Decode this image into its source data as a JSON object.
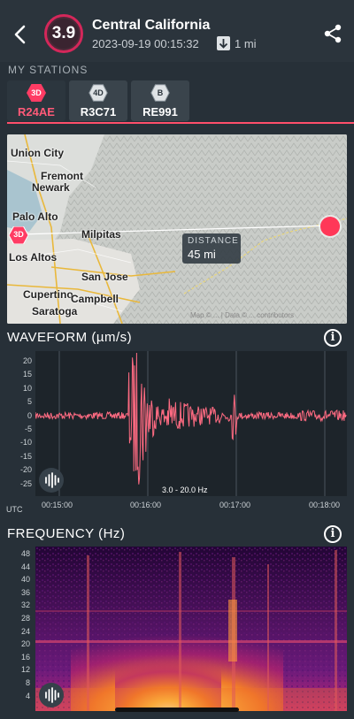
{
  "header": {
    "magnitude": "3.9",
    "title": "Central California",
    "datetime": "2023-09-19 00:15:32",
    "depth": "1 mi"
  },
  "stations": {
    "label": "MY STATIONS",
    "items": [
      {
        "type": "3D",
        "code": "R24AE",
        "selected": true
      },
      {
        "type": "4D",
        "code": "R3C71",
        "selected": false
      },
      {
        "type": "B",
        "code": "RE991",
        "selected": false
      }
    ]
  },
  "map": {
    "places": [
      "Union City",
      "Fremont",
      "Newark",
      "Palo Alto",
      "Milpitas",
      "Los Altos",
      "San Jose",
      "Cupertino",
      "Campbell",
      "Saratoga"
    ],
    "distance_label": "DISTANCE",
    "distance_value": "45 mi",
    "station_marker": "3D",
    "attribution": "Map © ... | Data © ... contributors"
  },
  "waveform": {
    "title": "WAVEFORM (µm/s)",
    "y_ticks": [
      "20",
      "15",
      "10",
      "5",
      "0",
      "-5",
      "-10",
      "-15",
      "-20",
      "-25"
    ],
    "x_axis_unit": "UTC",
    "x_ticks": [
      "00:15:00",
      "00:16:00",
      "00:17:00",
      "00:18:00"
    ],
    "filter": "3.0 - 20.0 Hz"
  },
  "frequency": {
    "title": "FREQUENCY (Hz)",
    "y_ticks": [
      "48",
      "44",
      "40",
      "36",
      "32",
      "28",
      "24",
      "20",
      "16",
      "12",
      "8",
      "4"
    ]
  },
  "icons": [
    "back-icon",
    "share-icon",
    "info-icon",
    "sound-wave-icon",
    "depth-arrow-icon"
  ],
  "colors": {
    "accent": "#ff4f6b",
    "magnitude_ring": "#d4275a",
    "waveform": "#ff6b82",
    "background": "#273038"
  }
}
